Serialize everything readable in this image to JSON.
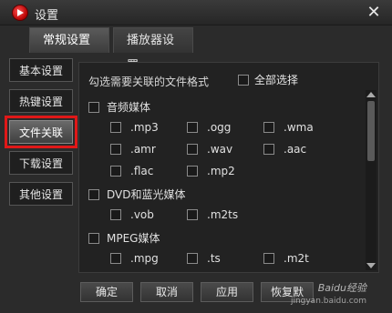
{
  "window": {
    "title": "设置"
  },
  "tabs": [
    {
      "label": "常规设置",
      "active": true
    },
    {
      "label": "播放器设置",
      "active": false
    }
  ],
  "sidebar": {
    "items": [
      {
        "label": "基本设置",
        "active": false
      },
      {
        "label": "热键设置",
        "active": false
      },
      {
        "label": "文件关联",
        "active": true
      },
      {
        "label": "下载设置",
        "active": false
      },
      {
        "label": "其他设置",
        "active": false
      }
    ]
  },
  "panel": {
    "header": "勾选需要关联的文件格式",
    "select_all": "全部选择",
    "groups": [
      {
        "title": "音频媒体",
        "items": [
          ".mp3",
          ".ogg",
          ".wma",
          ".amr",
          ".wav",
          ".aac",
          ".flac",
          ".mp2"
        ]
      },
      {
        "title": "DVD和蓝光媒体",
        "items": [
          ".vob",
          ".m2ts"
        ]
      },
      {
        "title": "MPEG媒体",
        "items": [
          ".mpg",
          ".ts",
          ".m2t"
        ]
      }
    ]
  },
  "footer": {
    "ok": "确定",
    "cancel": "取消",
    "apply": "应用",
    "restore": "恢复默"
  },
  "watermark": {
    "brand": "Baidu经验",
    "url": "jingyan.baidu.com"
  },
  "colors": {
    "highlight": "#e01818",
    "background": "#2b2b2b"
  }
}
